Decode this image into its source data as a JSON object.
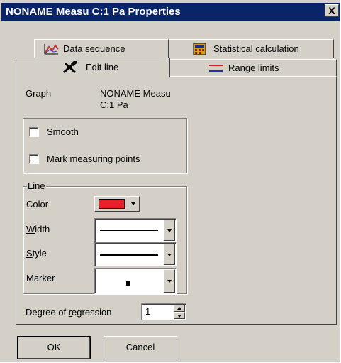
{
  "window": {
    "title": "NONAME Measu C:1 Pa Properties",
    "close_glyph": "X"
  },
  "tabs": [
    {
      "label": "Data sequence",
      "icon": "chart-icon"
    },
    {
      "label": "Statistical calculation",
      "icon": "calculator-icon"
    },
    {
      "label": "Edit line",
      "icon": "tools-icon",
      "active": true
    },
    {
      "label": "Range limits",
      "icon": "range-lines-icon"
    }
  ],
  "graph": {
    "label": "Graph",
    "value_line1": "NONAME Measu",
    "value_line2": "C:1 Pa"
  },
  "options": {
    "smooth": {
      "label": "Smooth",
      "accel": "S",
      "checked": false
    },
    "mark_points": {
      "label": "Mark measuring points",
      "accel": "M",
      "checked": false
    }
  },
  "line": {
    "group_label": "Line",
    "color_label": "Color",
    "color_value": "#e8202a",
    "width_label": "Width",
    "style_label": "Style",
    "marker_label": "Marker"
  },
  "regression": {
    "label": "Degree of regression",
    "value": "1"
  },
  "buttons": {
    "ok": "OK",
    "cancel": "Cancel"
  }
}
